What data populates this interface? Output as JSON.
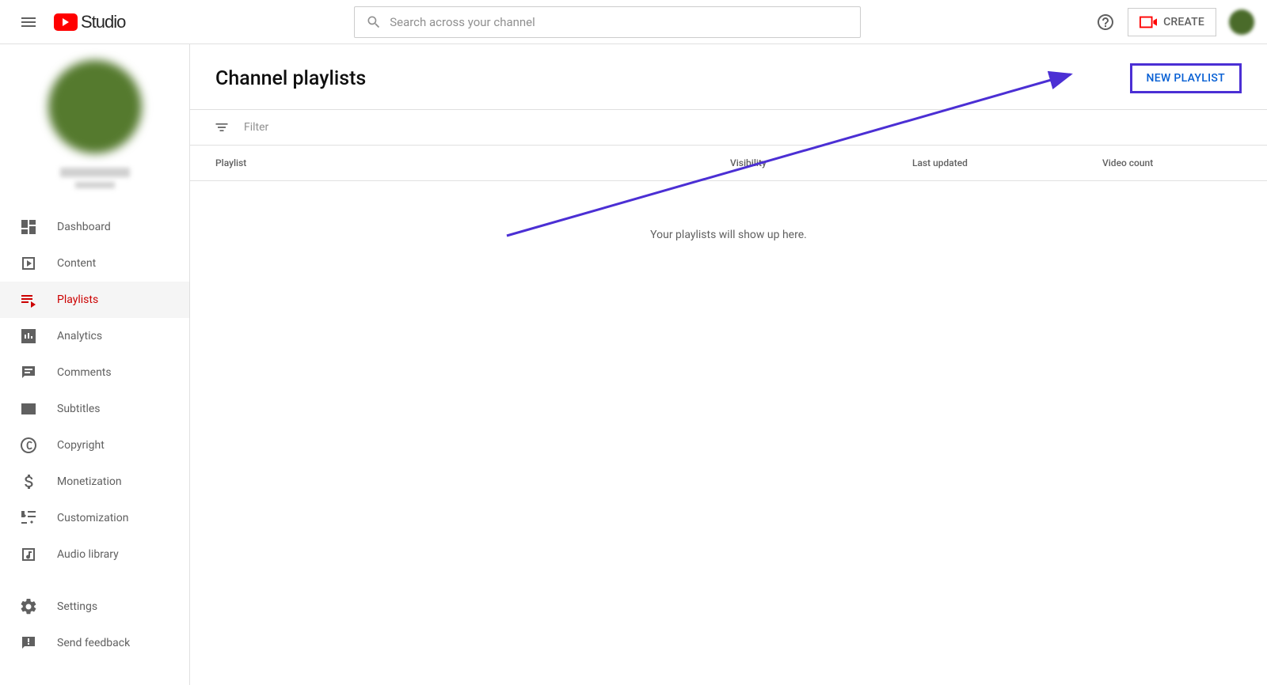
{
  "header": {
    "logo_text": "Studio",
    "search_placeholder": "Search across your channel",
    "create_label": "CREATE"
  },
  "sidebar": {
    "items": [
      {
        "id": "dashboard",
        "label": "Dashboard"
      },
      {
        "id": "content",
        "label": "Content"
      },
      {
        "id": "playlists",
        "label": "Playlists",
        "active": true
      },
      {
        "id": "analytics",
        "label": "Analytics"
      },
      {
        "id": "comments",
        "label": "Comments"
      },
      {
        "id": "subtitles",
        "label": "Subtitles"
      },
      {
        "id": "copyright",
        "label": "Copyright"
      },
      {
        "id": "monetization",
        "label": "Monetization"
      },
      {
        "id": "customization",
        "label": "Customization"
      },
      {
        "id": "audio",
        "label": "Audio library"
      }
    ],
    "bottom": [
      {
        "id": "settings",
        "label": "Settings"
      },
      {
        "id": "feedback",
        "label": "Send feedback"
      }
    ]
  },
  "main": {
    "title": "Channel playlists",
    "new_playlist_label": "NEW PLAYLIST",
    "filter_label": "Filter",
    "columns": {
      "playlist": "Playlist",
      "visibility": "Visibility",
      "updated": "Last updated",
      "count": "Video count"
    },
    "empty_message": "Your playlists will show up here."
  }
}
